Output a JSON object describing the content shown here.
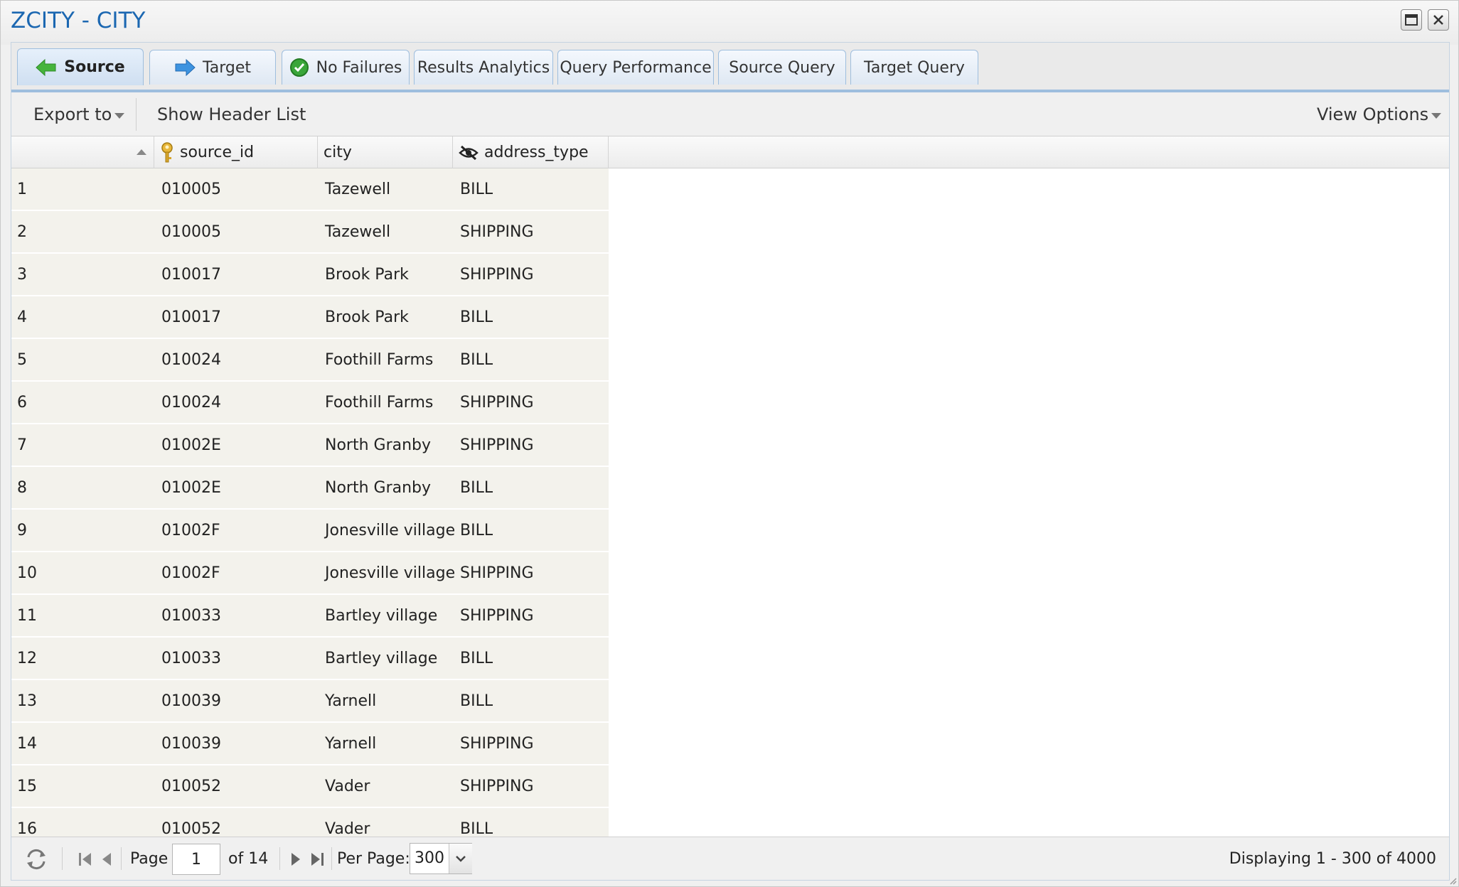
{
  "window": {
    "title": "ZCITY - CITY"
  },
  "tabs": [
    {
      "label": "Source",
      "icon": "arrow-left-green-icon",
      "active": true
    },
    {
      "label": "Target",
      "icon": "arrow-right-blue-icon"
    },
    {
      "label": "No Failures",
      "icon": "check-circle-green-icon"
    },
    {
      "label": "Results Analytics"
    },
    {
      "label": "Query Performance"
    },
    {
      "label": "Source Query"
    },
    {
      "label": "Target Query"
    }
  ],
  "toolbar": {
    "export_label": "Export to",
    "show_header_label": "Show Header List",
    "view_options_label": "View Options"
  },
  "grid": {
    "columns": [
      {
        "label": ""
      },
      {
        "label": "source_id",
        "icon": "key-icon"
      },
      {
        "label": "city"
      },
      {
        "label": "address_type",
        "icon": "eye-slash-icon"
      }
    ],
    "rows": [
      [
        "1",
        "010005",
        "Tazewell",
        "BILL"
      ],
      [
        "2",
        "010005",
        "Tazewell",
        "SHIPPING"
      ],
      [
        "3",
        "010017",
        "Brook Park",
        "SHIPPING"
      ],
      [
        "4",
        "010017",
        "Brook Park",
        "BILL"
      ],
      [
        "5",
        "010024",
        "Foothill Farms",
        "BILL"
      ],
      [
        "6",
        "010024",
        "Foothill Farms",
        "SHIPPING"
      ],
      [
        "7",
        "01002E",
        "North Granby",
        "SHIPPING"
      ],
      [
        "8",
        "01002E",
        "North Granby",
        "BILL"
      ],
      [
        "9",
        "01002F",
        "Jonesville village",
        "BILL"
      ],
      [
        "10",
        "01002F",
        "Jonesville village",
        "SHIPPING"
      ],
      [
        "11",
        "010033",
        "Bartley village",
        "SHIPPING"
      ],
      [
        "12",
        "010033",
        "Bartley village",
        "BILL"
      ],
      [
        "13",
        "010039",
        "Yarnell",
        "BILL"
      ],
      [
        "14",
        "010039",
        "Yarnell",
        "SHIPPING"
      ],
      [
        "15",
        "010052",
        "Vader",
        "SHIPPING"
      ],
      [
        "16",
        "010052",
        "Vader",
        "BILL"
      ]
    ]
  },
  "pager": {
    "page_label": "Page",
    "page_value": "1",
    "of_label": "of 14",
    "per_page_label": "Per Page:",
    "per_page_value": "300",
    "display_text": "Displaying 1 - 300 of 4000"
  },
  "colors": {
    "title": "#1b67b1",
    "tab_border": "#9ebede",
    "row_bg": "#f3f2ec"
  }
}
